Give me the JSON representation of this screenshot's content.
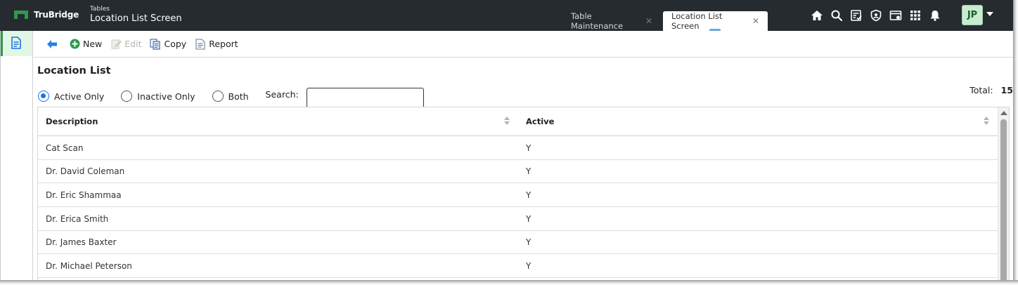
{
  "app": {
    "brand": "TruBridge",
    "section": "Tables",
    "screen_title": "Location List Screen"
  },
  "tabs": [
    {
      "label": "Table Maintenance",
      "active": false
    },
    {
      "label": "Location List Screen",
      "active": true
    }
  ],
  "header_icons": [
    "home-icon",
    "search-icon",
    "checklist-icon",
    "shield-icon",
    "calendar-icon",
    "apps-grid-icon",
    "bell-icon"
  ],
  "user": {
    "initials": "JP"
  },
  "toolbar": {
    "back_icon": "back-arrow-icon",
    "new_label": "New",
    "edit_label": "Edit",
    "copy_label": "Copy",
    "report_label": "Report"
  },
  "page": {
    "title": "Location List",
    "filters": {
      "active_only": "Active Only",
      "inactive_only": "Inactive Only",
      "both": "Both",
      "selected": "Active Only"
    },
    "search_label": "Search:",
    "search_value": "",
    "total_label": "Total:",
    "total_count": "15"
  },
  "table": {
    "columns": [
      "Description",
      "Active"
    ],
    "rows": [
      {
        "description": "Cat Scan",
        "active": "Y"
      },
      {
        "description": "Dr. David Coleman",
        "active": "Y"
      },
      {
        "description": "Dr. Eric Shammaa",
        "active": "Y"
      },
      {
        "description": "Dr. Erica Smith",
        "active": "Y"
      },
      {
        "description": "Dr. James Baxter",
        "active": "Y"
      },
      {
        "description": "Dr. Michael Peterson",
        "active": "Y"
      }
    ]
  },
  "colors": {
    "topbar": "#262b30",
    "brand_green": "#2e9a4c",
    "radio_blue": "#1a73e8",
    "avatar_bg": "#c9ecd1"
  }
}
